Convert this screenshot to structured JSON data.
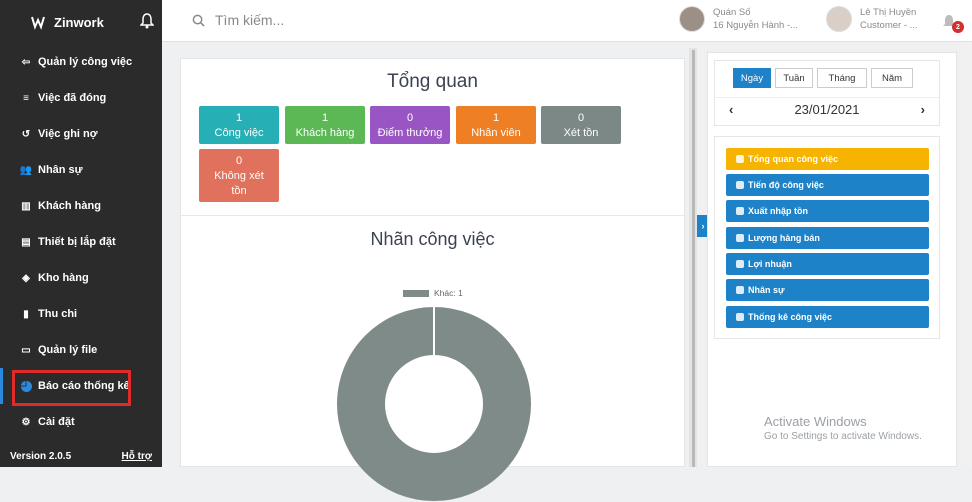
{
  "app": {
    "name": "Zinwork",
    "version": "Version 2.0.5",
    "help": "Hỗ trợ"
  },
  "sidebar": {
    "items": [
      {
        "label": "Quản lý công việc",
        "icon": "list-icon"
      },
      {
        "label": "Việc đã đóng",
        "icon": "checklist-icon"
      },
      {
        "label": "Việc ghi nợ",
        "icon": "history-icon"
      },
      {
        "label": "Nhân sự",
        "icon": "users-icon"
      },
      {
        "label": "Khách hàng",
        "icon": "book-icon"
      },
      {
        "label": "Thiết bị lắp đặt",
        "icon": "printer-icon"
      },
      {
        "label": "Kho hàng",
        "icon": "layers-icon"
      },
      {
        "label": "Thu chi",
        "icon": "document-icon"
      },
      {
        "label": "Quản lý file",
        "icon": "folder-icon"
      },
      {
        "label": "Báo cáo thống kê",
        "icon": "pie-chart-icon"
      },
      {
        "label": "Cài đặt",
        "icon": "settings-icon"
      }
    ]
  },
  "topbar": {
    "search_placeholder": "Tìm kiếm...",
    "store": {
      "name": "Quán Số",
      "address": "16 Nguyễn Hành -..."
    },
    "user": {
      "name": "Lê Thị Huyền",
      "role": "Customer - ..."
    },
    "notification_count": "2"
  },
  "overview": {
    "title": "Tổng quan",
    "tiles": [
      {
        "value": "1",
        "label": "Công việc",
        "color": "#26b0b5"
      },
      {
        "value": "1",
        "label": "Khách hàng",
        "color": "#5bb854"
      },
      {
        "value": "0",
        "label": "Điểm thưởng",
        "color": "#9a55c4"
      },
      {
        "value": "1",
        "label": "Nhân viên",
        "color": "#ef7f24"
      },
      {
        "value": "0",
        "label": "Xét tồn",
        "color": "#7b8886"
      },
      {
        "value": "0",
        "label": "Không xét",
        "label2": "tồn",
        "color": "#e0715c"
      }
    ]
  },
  "labels_chart": {
    "title": "Nhãn công việc",
    "chart_data": {
      "type": "pie",
      "categories": [
        "Khác"
      ],
      "values": [
        1
      ],
      "legend": [
        "Khác: 1"
      ],
      "colors": [
        "#7f8b88"
      ]
    }
  },
  "calendar": {
    "periods": [
      "Ngày",
      "Tuần",
      "Tháng",
      "Năm"
    ],
    "active_period": "Ngày",
    "date": "23/01/2021"
  },
  "reports": [
    {
      "label": "Tổng quan công việc",
      "color": "#f6b400"
    },
    {
      "label": "Tiến độ công việc",
      "color": "#1e82c8"
    },
    {
      "label": "Xuất nhập tồn",
      "color": "#1e82c8"
    },
    {
      "label": "Lượng hàng bán",
      "color": "#1e82c8"
    },
    {
      "label": "Lợi nhuận",
      "color": "#1e82c8"
    },
    {
      "label": "Nhân sự",
      "color": "#1e82c8"
    },
    {
      "label": "Thống kê công việc",
      "color": "#1e82c8"
    }
  ],
  "watermark": {
    "line1": "Activate Windows",
    "line2": "Go to Settings to activate Windows."
  }
}
